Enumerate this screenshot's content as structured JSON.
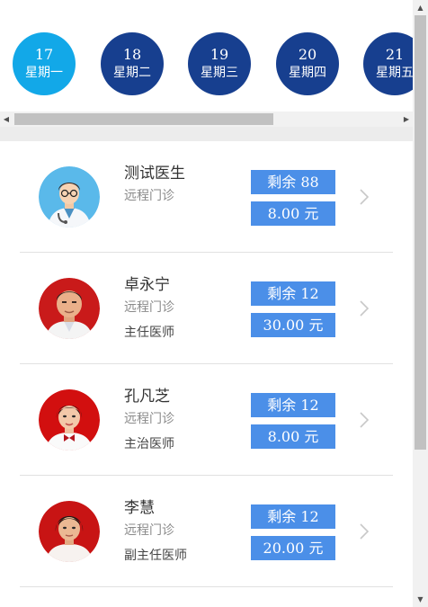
{
  "dates": [
    {
      "day": "17",
      "weekday": "星期一",
      "active": true
    },
    {
      "day": "18",
      "weekday": "星期二",
      "active": false
    },
    {
      "day": "19",
      "weekday": "星期三",
      "active": false
    },
    {
      "day": "20",
      "weekday": "星期四",
      "active": false
    },
    {
      "day": "21",
      "weekday": "星期五",
      "active": false
    }
  ],
  "doctors": [
    {
      "name": "测试医生",
      "dept": "远程门诊",
      "title": "",
      "remaining": "剩余 88",
      "price": "8.00 元",
      "avatar": "cartoon-doctor"
    },
    {
      "name": "卓永宁",
      "dept": "远程门诊",
      "title": "主任医师",
      "remaining": "剩余 12",
      "price": "30.00 元",
      "avatar": "male-doctor-photo"
    },
    {
      "name": "孔凡芝",
      "dept": "远程门诊",
      "title": "主治医师",
      "remaining": "剩余 12",
      "price": "8.00 元",
      "avatar": "female-doctor-photo"
    },
    {
      "name": "李慧",
      "dept": "远程门诊",
      "title": "副主任医师",
      "remaining": "剩余 12",
      "price": "20.00 元",
      "avatar": "female-doctor-photo"
    }
  ],
  "colors": {
    "active_date": "#12a8e8",
    "inactive_date": "#173f8f",
    "badge": "#4b8fe8"
  },
  "icons": {
    "scroll_left": "◀",
    "scroll_right": "▶",
    "scroll_up": "▲",
    "scroll_down": "▼",
    "row_arrow": "chevron-right-icon"
  }
}
